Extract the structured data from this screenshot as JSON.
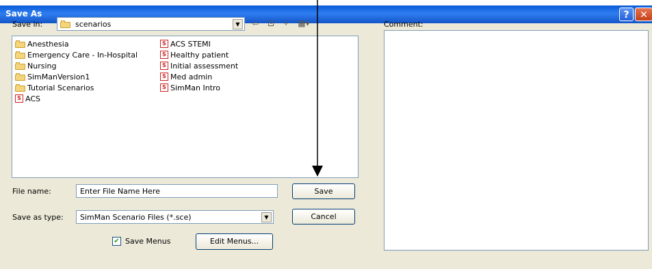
{
  "window": {
    "title": "Save As",
    "help_label": "?",
    "close_label": "✕"
  },
  "save_in": {
    "label": "Save in:",
    "value": "scenarios"
  },
  "toolbar": {
    "back_icon": "back-arrow-icon",
    "up_icon": "up-folder-icon",
    "new_folder_icon": "new-folder-icon",
    "views_icon": "views-menu-icon"
  },
  "files": [
    {
      "name": "Anesthesia",
      "type": "folder"
    },
    {
      "name": "Emergency Care - In-Hospital",
      "type": "folder"
    },
    {
      "name": "Nursing",
      "type": "folder"
    },
    {
      "name": "SimManVersion1",
      "type": "folder"
    },
    {
      "name": "Tutorial Scenarios",
      "type": "folder"
    },
    {
      "name": "ACS",
      "type": "scenario"
    },
    {
      "name": "ACS STEMI",
      "type": "scenario"
    },
    {
      "name": "Healthy patient",
      "type": "scenario"
    },
    {
      "name": "Initial assessment",
      "type": "scenario"
    },
    {
      "name": "Med admin",
      "type": "scenario"
    },
    {
      "name": "SimMan Intro",
      "type": "scenario"
    }
  ],
  "file_name": {
    "label": "File name:",
    "value": "Enter File Name Here"
  },
  "save_as_type": {
    "label": "Save as type:",
    "value": "SimMan Scenario Files (*.sce)"
  },
  "save_label": "Save",
  "cancel_label": "Cancel",
  "save_menus": {
    "label": "Save Menus",
    "checked": true
  },
  "edit_menus_label": "Edit Menus...",
  "comment": {
    "label": "Comment:",
    "value": ""
  }
}
